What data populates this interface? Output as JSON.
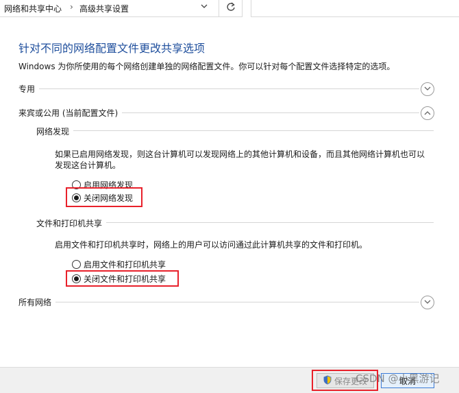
{
  "address_bar": {
    "crumbs": [
      "网络和共享中心",
      "高级共享设置"
    ],
    "separator": "›",
    "dropdown_icon": "chevron-down-icon",
    "refresh_icon": "refresh-icon"
  },
  "page": {
    "title": "针对不同的网络配置文件更改共享选项",
    "description": "Windows 为你所使用的每个网络创建单独的网络配置文件。你可以针对每个配置文件选择特定的选项。"
  },
  "profiles": {
    "private": {
      "label": "专用",
      "expanded": false
    },
    "guest": {
      "label": "来宾或公用 (当前配置文件)",
      "expanded": true,
      "network_discovery": {
        "label": "网络发现",
        "description": "如果已启用网络发现，则这台计算机可以发现网络上的其他计算机和设备，而且其他网络计算机也可以发现这台计算机。",
        "options": [
          {
            "label": "启用网络发现",
            "checked": false
          },
          {
            "label": "关闭网络发现",
            "checked": true
          }
        ]
      },
      "file_sharing": {
        "label": "文件和打印机共享",
        "description": "启用文件和打印机共享时，网络上的用户可以访问通过此计算机共享的文件和打印机。",
        "options": [
          {
            "label": "启用文件和打印机共享",
            "checked": false
          },
          {
            "label": "关闭文件和打印机共享",
            "checked": true
          }
        ]
      }
    },
    "all": {
      "label": "所有网络",
      "expanded": false
    }
  },
  "footer": {
    "save_label": "保存更改",
    "cancel_label": "取消",
    "watermark": "CSDN @小黑游记"
  },
  "colors": {
    "title": "#1e4e9c",
    "highlight": "#e8202a",
    "cancel_border": "#3b7ad6"
  }
}
